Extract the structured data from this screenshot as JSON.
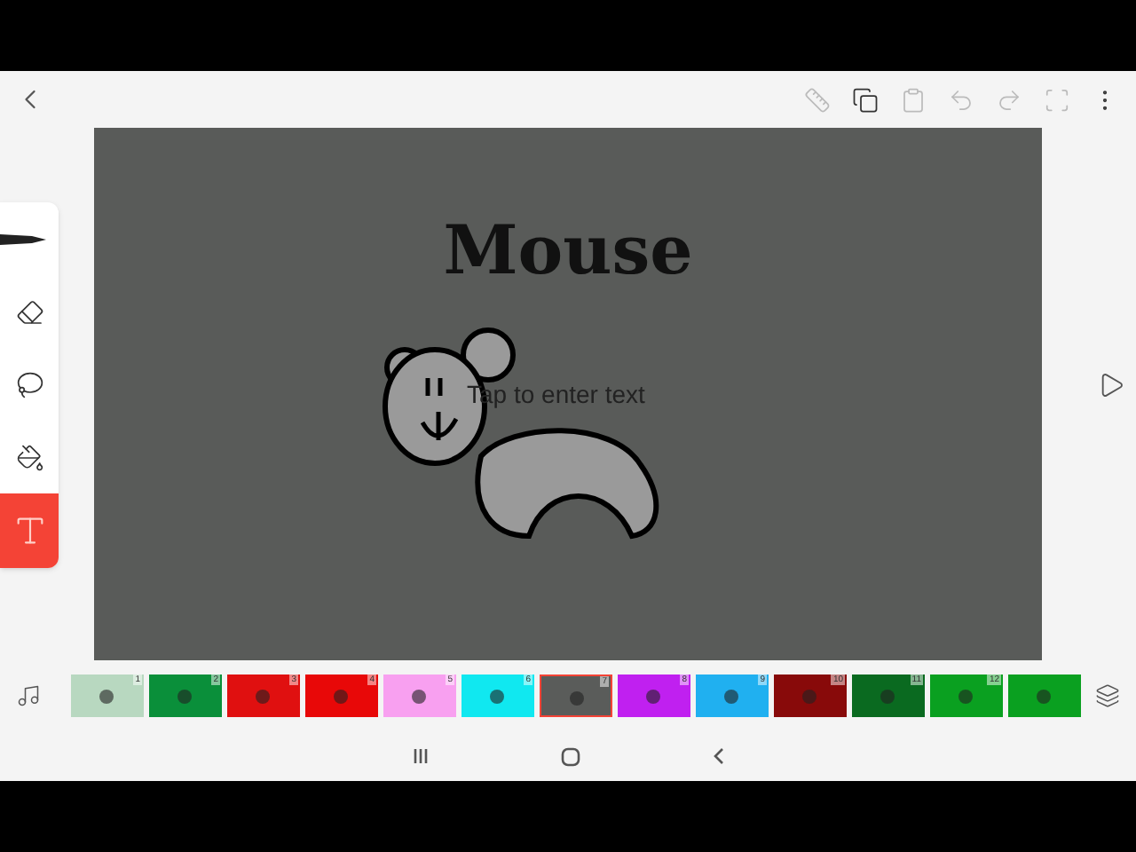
{
  "toolbar": [
    {
      "kind": "ruler",
      "disabled": true
    },
    {
      "kind": "copy",
      "disabled": false
    },
    {
      "kind": "paste",
      "disabled": true
    },
    {
      "kind": "undo",
      "disabled": true
    },
    {
      "kind": "redo",
      "disabled": true
    },
    {
      "kind": "fullscreen",
      "disabled": true
    },
    {
      "kind": "more",
      "disabled": false
    }
  ],
  "tools": [
    {
      "kind": "pen",
      "selected": false
    },
    {
      "kind": "eraser",
      "selected": false
    },
    {
      "kind": "lasso",
      "selected": false
    },
    {
      "kind": "fill",
      "selected": false
    },
    {
      "kind": "text",
      "selected": true
    }
  ],
  "canvas": {
    "title": "Mouse",
    "text_field": {
      "placeholder": "Tap to enter text"
    }
  },
  "frames": [
    {
      "number": "1",
      "color": "#b8d8c0",
      "selected": false
    },
    {
      "number": "2",
      "color": "#0a8f3a",
      "selected": false
    },
    {
      "number": "3",
      "color": "#e01010",
      "selected": false
    },
    {
      "number": "4",
      "color": "#e80808",
      "selected": false
    },
    {
      "number": "5",
      "color": "#f8a0f0",
      "selected": false
    },
    {
      "number": "6",
      "color": "#10e8f0",
      "selected": false
    },
    {
      "number": "7",
      "color": "#5a5c5a",
      "selected": true
    },
    {
      "number": "8",
      "color": "#c020f0",
      "selected": false
    },
    {
      "number": "9",
      "color": "#20b0f0",
      "selected": false
    },
    {
      "number": "10",
      "color": "#880a0a",
      "selected": false
    },
    {
      "number": "11",
      "color": "#0a6a20",
      "selected": false
    },
    {
      "number": "12",
      "color": "#0aa020",
      "selected": false
    },
    {
      "color": "#0aa020",
      "selected": false
    }
  ]
}
